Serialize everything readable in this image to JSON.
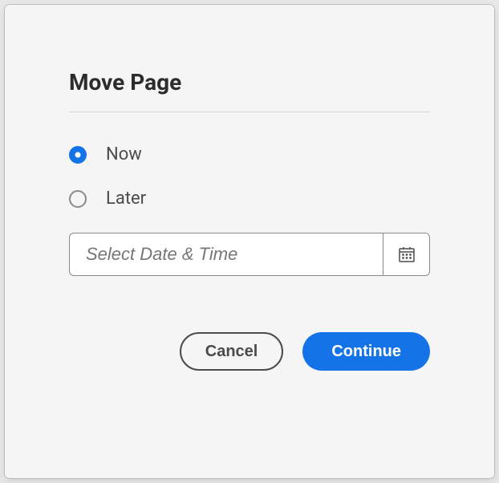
{
  "dialog": {
    "title": "Move Page",
    "options": {
      "now": {
        "label": "Now",
        "selected": true
      },
      "later": {
        "label": "Later",
        "selected": false
      }
    },
    "dateField": {
      "placeholder": "Select Date & Time",
      "value": ""
    },
    "buttons": {
      "cancel": "Cancel",
      "continue": "Continue"
    }
  }
}
